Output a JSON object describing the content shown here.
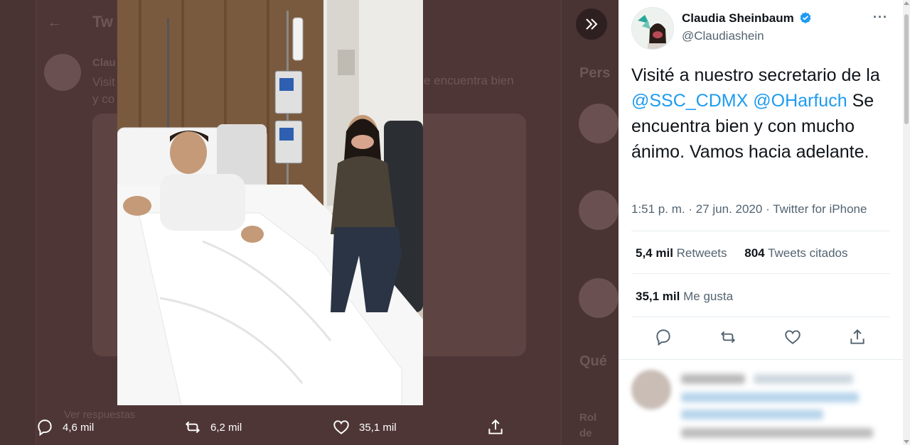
{
  "background": {
    "header_title": "Tw",
    "tweet_author": "Clau",
    "tweet_text_start": "Visit",
    "tweet_text_line2": "y co",
    "tweet_text_end": "e encuentra bien",
    "right_title": "Pers",
    "right_title2": "Qué",
    "right_item_1": "Rol",
    "right_item_2": "de",
    "replies_label": "Ver respuestas"
  },
  "photo_actions": {
    "replies": "4,6 mil",
    "retweets": "6,2 mil",
    "likes": "35,1 mil"
  },
  "tweet": {
    "author_name": "Claudia Sheinbaum",
    "author_handle": "@Claudiashein",
    "text_part1": "Visité a nuestro secretario de la ",
    "mention1": "@SSC_CDMX",
    "mention2": "@OHarfuch",
    "text_part2": " Se encuentra bien y con mucho ánimo. Vamos hacia adelante.",
    "time": "1:51 p. m.",
    "separator": "·",
    "date": "27 jun. 2020",
    "source": "Twitter for iPhone",
    "retweets_count": "5,4 mil",
    "retweets_label": "Retweets",
    "quotes_count": "804",
    "quotes_label": "Tweets citados",
    "likes_count": "35,1 mil",
    "likes_label": "Me gusta",
    "more_label": "···"
  },
  "colors": {
    "accent": "#1d9bf0",
    "overlay": "#4a3333"
  }
}
